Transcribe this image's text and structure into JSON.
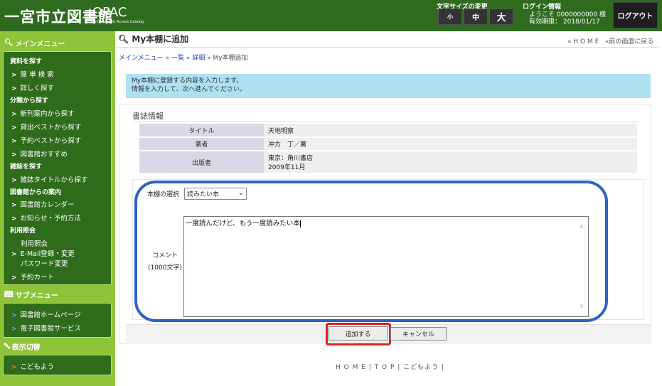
{
  "header": {
    "logo_text": "一宮市立図書館",
    "opac": "OPAC",
    "opac_sub": "Online Public Access Catalog",
    "font_size_label": "文字サイズの変更",
    "font_small": "小",
    "font_mid": "中",
    "font_large": "大",
    "login_label": "ログイン情報",
    "login_welcome": "ようこそ 0000000000 様",
    "login_expire": "有効期限： 2018/01/17",
    "logout": "ログアウト",
    "colors": {
      "header_bg": "#2f6b1f",
      "sidebar_bg": "#8fc33a"
    }
  },
  "sidebar": {
    "main_menu_title": "メインメニュー",
    "sec_search": "資料を探す",
    "simple_search": "簡 単 検 索",
    "detail_search": "詳しく探す",
    "sec_category": "分類から探す",
    "new_books": "新刊案内から探す",
    "loan_best": "貸出ベストから探す",
    "reserve_best": "予約ベストから探す",
    "library_recommend": "図書館おすすめ",
    "sec_magazine": "雑誌を探す",
    "magazine_title": "雑誌タイトルから探す",
    "sec_guide": "図書館からの案内",
    "calendar": "図書館カレンダー",
    "notice": "お知らせ・予約方法",
    "sec_usage": "利用照会",
    "usage": "利用照会",
    "email_change": "E-Mail登録・変更",
    "password_change": "パスワード変更",
    "reserve_cart": "予約カート",
    "sub_menu_title": "サブメニュー",
    "library_home": "図書館ホームページ",
    "e_library": "電子図書館サービス",
    "display_switch_title": "表示切替",
    "kids": "こどもよう"
  },
  "main": {
    "page_title": "My本棚に追加",
    "top_home": "« H O M E",
    "top_back": "«前の画面に戻る",
    "breadcrumb": {
      "main_menu": "メインメニュー",
      "sep": " » ",
      "list": "一覧",
      "detail": "詳細",
      "current": "My本棚追加"
    },
    "info_line1": "My本棚に登録する内容を入力します。",
    "info_line2": "情報を入力して、次へ進んでください。",
    "biblio_title": "書誌情報",
    "biblio": {
      "title_label": "タイトル",
      "title_value": "天地明察",
      "author_label": "著者",
      "author_value": "冲方　丁／著",
      "publisher_label": "出版者",
      "publisher_value1": "東京：角川書店",
      "publisher_value2": "2009年11月"
    },
    "shelf_label": "本棚の選択",
    "shelf_selected": "読みたい本",
    "comment_label1": "コメント",
    "comment_label2": "(1000文字)",
    "comment_value": "一度読んだけど、もう一度読みたい本",
    "add_button": "追加する",
    "cancel_button": "キャンセル",
    "highlight_colors": {
      "oval": "#2e62c9",
      "add_outline": "#e02020"
    }
  },
  "footer": {
    "home": "H O M E",
    "top": "T O P",
    "kids": "こどもよう",
    "sep": " | "
  }
}
